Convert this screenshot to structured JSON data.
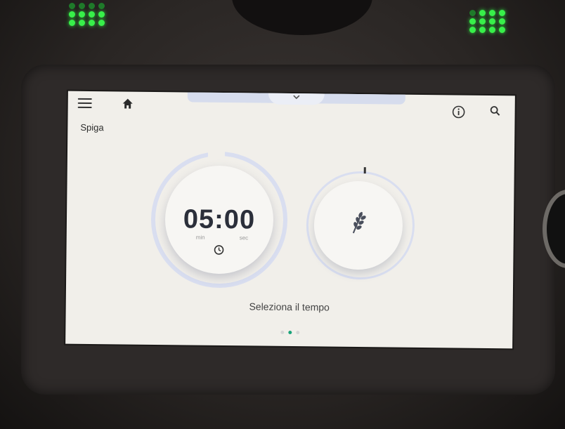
{
  "screen": {
    "title": "Spiga",
    "hint": "Seleziona il tempo"
  },
  "timer": {
    "value": "05:00",
    "unit_min": "min",
    "unit_sec": "sec"
  },
  "icons": {
    "menu": "hamburger-menu-icon",
    "home": "home-icon",
    "info": "info-icon",
    "search": "search-icon",
    "pulldown": "chevron-down-icon",
    "clock": "clock-icon",
    "program": "wheat-grain-icon"
  },
  "pager": {
    "pages": 3,
    "active_index": 1
  },
  "colors": {
    "screen_bg": "#f1efea",
    "ring": "#d9def0",
    "led": "#38f04a",
    "active_dot": "#1aa37a"
  }
}
